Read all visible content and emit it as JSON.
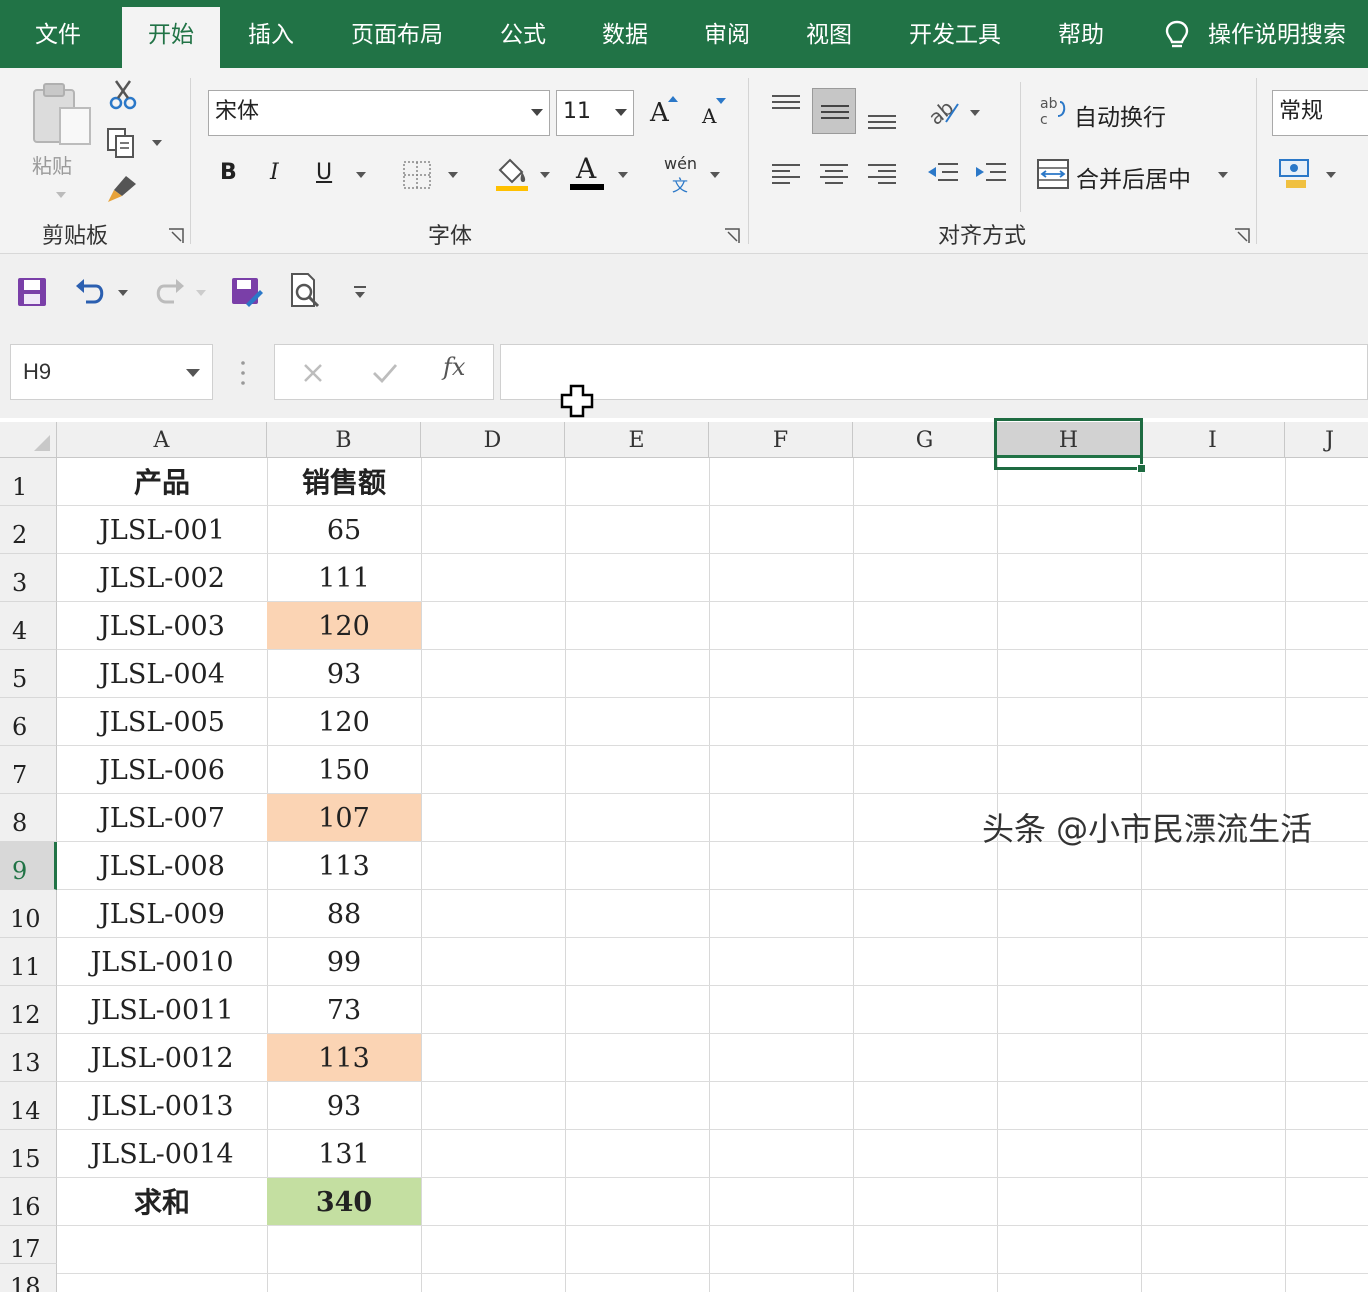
{
  "tabs": [
    "文件",
    "开始",
    "插入",
    "页面布局",
    "公式",
    "数据",
    "审阅",
    "视图",
    "开发工具",
    "帮助",
    "操作说明搜索"
  ],
  "active_tab": "开始",
  "ribbon": {
    "paste_label": "粘贴",
    "clipboard_group": "剪贴板",
    "font_group": "字体",
    "align_group": "对齐方式",
    "font_name": "宋体",
    "font_size": "11",
    "bold": "B",
    "italic": "I",
    "underline": "U",
    "font_color_glyph": "A",
    "grow_font": "A",
    "shrink_font": "A",
    "phonetic": "wén",
    "phonetic_sub": "文",
    "wrap_text": "自动换行",
    "merge_center": "合并后居中",
    "number_format": "常规",
    "font_color_hex": "#000000",
    "fill_color_hex": "#ffc000"
  },
  "formula_bar": {
    "name_box": "H9",
    "fx": "fx",
    "value": ""
  },
  "sheet": {
    "columns": [
      "A",
      "B",
      "D",
      "E",
      "F",
      "G",
      "H",
      "I",
      "J"
    ],
    "selected_column": "H",
    "rows": [
      "1",
      "2",
      "3",
      "4",
      "5",
      "6",
      "7",
      "8",
      "9",
      "10",
      "11",
      "12",
      "13",
      "14",
      "15",
      "16",
      "17",
      "18"
    ],
    "selected_row": "9",
    "header": {
      "a": "产品",
      "b": "销售额"
    },
    "data": [
      {
        "a": "JLSL-001",
        "b": "65",
        "hl": ""
      },
      {
        "a": "JLSL-002",
        "b": "111",
        "hl": ""
      },
      {
        "a": "JLSL-003",
        "b": "120",
        "hl": "orange"
      },
      {
        "a": "JLSL-004",
        "b": "93",
        "hl": ""
      },
      {
        "a": "JLSL-005",
        "b": "120",
        "hl": ""
      },
      {
        "a": "JLSL-006",
        "b": "150",
        "hl": ""
      },
      {
        "a": "JLSL-007",
        "b": "107",
        "hl": "orange"
      },
      {
        "a": "JLSL-008",
        "b": "113",
        "hl": ""
      },
      {
        "a": "JLSL-009",
        "b": "88",
        "hl": ""
      },
      {
        "a": "JLSL-0010",
        "b": "99",
        "hl": ""
      },
      {
        "a": "JLSL-0011",
        "b": "73",
        "hl": ""
      },
      {
        "a": "JLSL-0012",
        "b": "113",
        "hl": "orange"
      },
      {
        "a": "JLSL-0013",
        "b": "93",
        "hl": ""
      },
      {
        "a": "JLSL-0014",
        "b": "131",
        "hl": ""
      }
    ],
    "total": {
      "a": "求和",
      "b": "340"
    },
    "highlight_orange": "#fbd4b4",
    "highlight_green": "#c4dfa1",
    "accent": "#217346"
  },
  "watermark": "头条 @小市民漂流生活"
}
